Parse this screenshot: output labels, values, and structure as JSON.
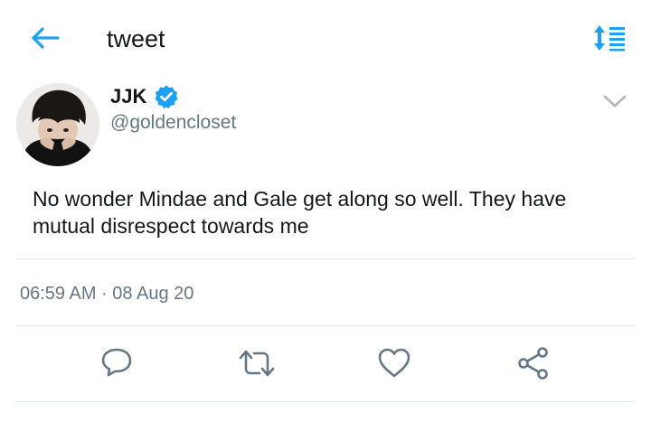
{
  "header": {
    "title": "tweet",
    "back_icon": "arrow-left-icon",
    "sort_icon": "sort-icon",
    "accent_color": "#1da1f2"
  },
  "tweet": {
    "display_name": "JJK",
    "verified": true,
    "handle": "@goldencloset",
    "text": "No wonder Mindae and Gale get along so well. They have mutual disrespect towards me",
    "timestamp": "06:59 AM · 08 Aug 20"
  },
  "actions": [
    {
      "name": "reply",
      "icon": "reply-icon"
    },
    {
      "name": "retweet",
      "icon": "retweet-icon"
    },
    {
      "name": "like",
      "icon": "heart-icon"
    },
    {
      "name": "share",
      "icon": "share-icon"
    }
  ],
  "colors": {
    "text": "#14171a",
    "secondary": "#657786",
    "divider": "#e1e8ed",
    "verified": "#1da1f2"
  }
}
